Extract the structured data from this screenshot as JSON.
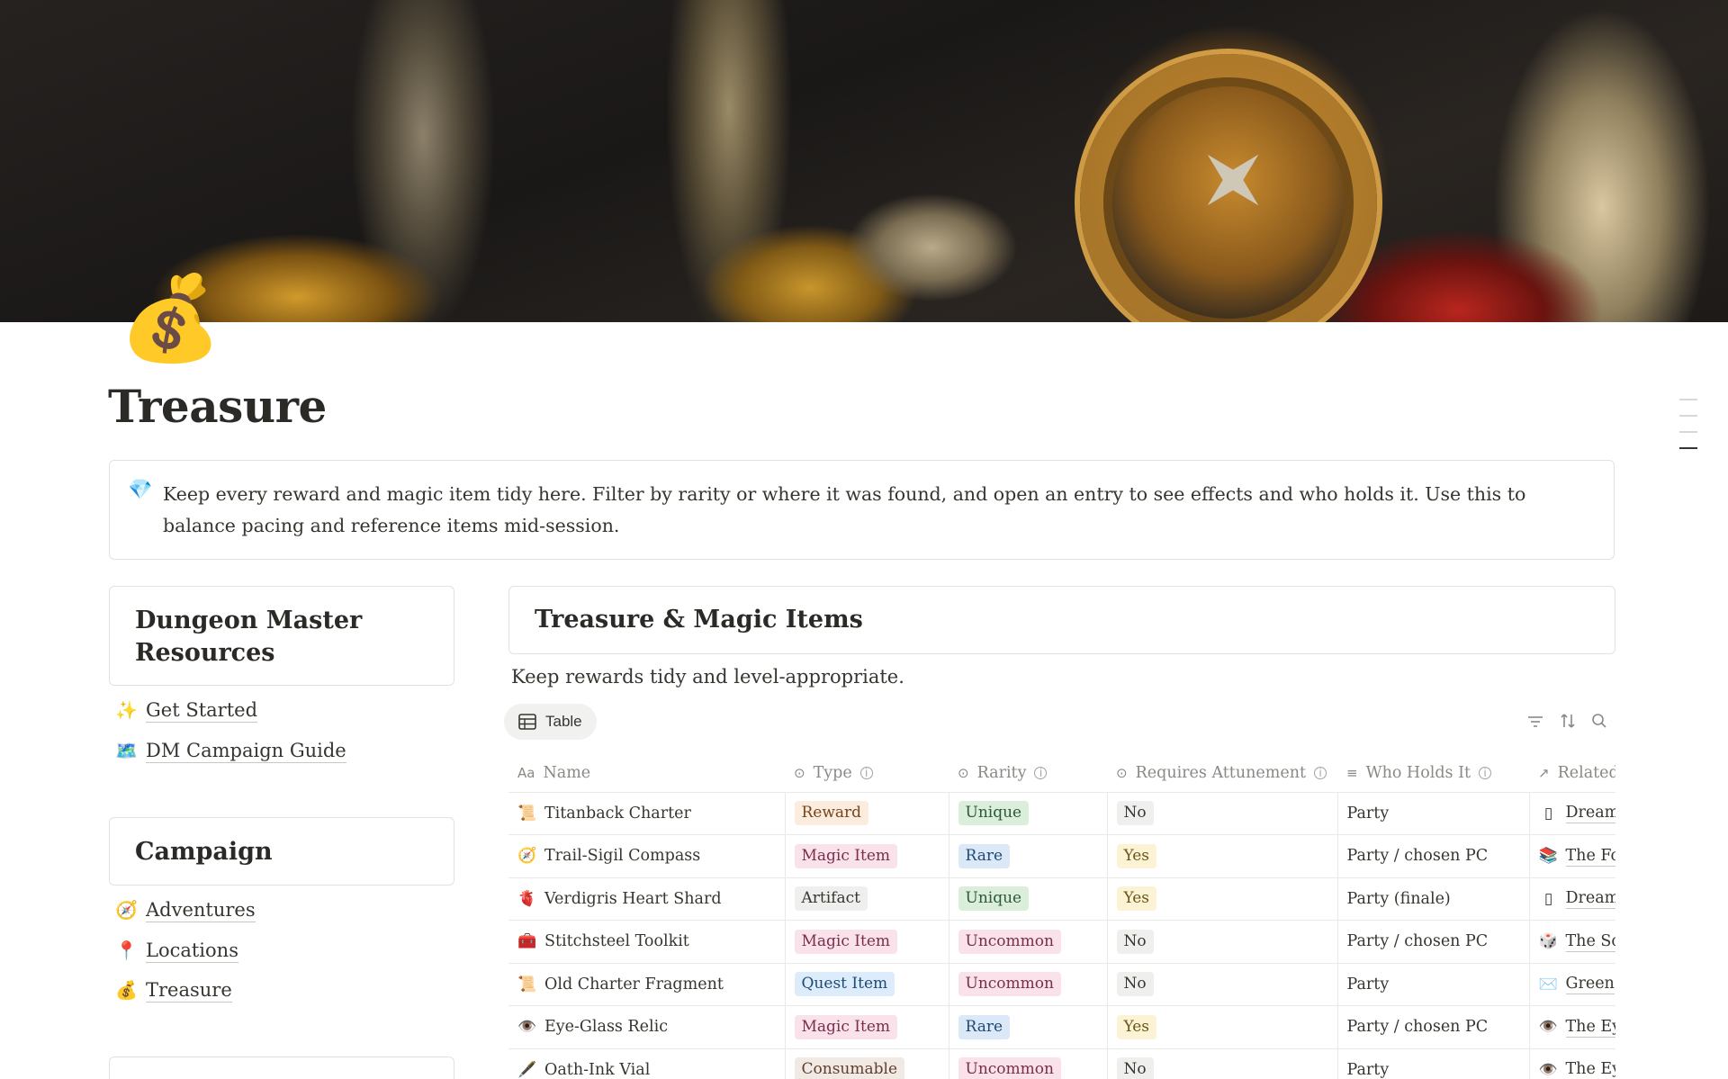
{
  "page": {
    "icon": "💰",
    "title": "Treasure"
  },
  "callout": {
    "icon": "💎",
    "text": "Keep every reward and magic item tidy here. Filter by rarity or where it was found, and open an entry to see effects and who holds it. Use this to balance pacing and reference items mid-session."
  },
  "sidebar": {
    "dm_heading": "Dungeon Master Resources",
    "dm_links": [
      {
        "icon": "✨",
        "label": "Get Started"
      },
      {
        "icon": "🗺️",
        "label": "DM Campaign Guide"
      }
    ],
    "campaign_heading": "Campaign",
    "campaign_links": [
      {
        "icon": "🧭",
        "label": "Adventures"
      },
      {
        "icon": "📍",
        "label": "Locations"
      },
      {
        "icon": "💰",
        "label": "Treasure"
      }
    ]
  },
  "database": {
    "heading": "Treasure & Magic Items",
    "description": "Keep rewards tidy and level-appropriate.",
    "view_tab": {
      "icon": "table-icon",
      "label": "Table"
    },
    "toolbar_icons": [
      "filter-icon",
      "sort-icon",
      "search-icon"
    ],
    "columns": [
      {
        "icon": "Aa",
        "label": "Name",
        "info": false
      },
      {
        "icon": "⊙",
        "label": "Type",
        "info": true
      },
      {
        "icon": "⊙",
        "label": "Rarity",
        "info": true
      },
      {
        "icon": "⊙",
        "label": "Requires Attunement",
        "info": true
      },
      {
        "icon": "≡",
        "label": "Who Holds It",
        "info": true
      },
      {
        "icon": "↗",
        "label": "Related",
        "info": false
      }
    ],
    "rows": [
      {
        "icon": "📜",
        "name": "Titanback Charter",
        "type": "Reward",
        "rarity": "Unique",
        "attune": "No",
        "holder": "Party",
        "rel_icon": "▯",
        "related": "Dream"
      },
      {
        "icon": "🧭",
        "name": "Trail-Sigil Compass",
        "type": "Magic Item",
        "rarity": "Rare",
        "attune": "Yes",
        "holder": "Party / chosen PC",
        "rel_icon": "📚",
        "related": "The Fo"
      },
      {
        "icon": "🫀",
        "name": "Verdigris Heart Shard",
        "type": "Artifact",
        "rarity": "Unique",
        "attune": "Yes",
        "holder": "Party (finale)",
        "rel_icon": "▯",
        "related": "Dream"
      },
      {
        "icon": "🧰",
        "name": "Stitchsteel Toolkit",
        "type": "Magic Item",
        "rarity": "Uncommon",
        "attune": "No",
        "holder": "Party / chosen PC",
        "rel_icon": "🎲",
        "related": "The Sc"
      },
      {
        "icon": "📜",
        "name": "Old Charter Fragment",
        "type": "Quest Item",
        "rarity": "Uncommon",
        "attune": "No",
        "holder": "Party",
        "rel_icon": "✉️",
        "related": "Green"
      },
      {
        "icon": "👁️",
        "name": "Eye-Glass Relic",
        "type": "Magic Item",
        "rarity": "Rare",
        "attune": "Yes",
        "holder": "Party / chosen PC",
        "rel_icon": "👁️",
        "related": "The Ey"
      },
      {
        "icon": "🖋️",
        "name": "Oath-Ink Vial",
        "type": "Consumable",
        "rarity": "Uncommon",
        "attune": "No",
        "holder": "Party",
        "rel_icon": "👁️",
        "related": "The Ey"
      }
    ],
    "tag_colors": {
      "Reward": {
        "bg": "#fbecdd",
        "fg": "#73451f"
      },
      "Magic Item": {
        "bg": "#f9e2ea",
        "fg": "#7a2e4c"
      },
      "Artifact": {
        "bg": "#efefed",
        "fg": "#37352f"
      },
      "Quest Item": {
        "bg": "#dcecfb",
        "fg": "#1f4a73"
      },
      "Consumable": {
        "bg": "#f1e9e3",
        "fg": "#5e4030"
      },
      "Unique": {
        "bg": "#dbeddb",
        "fg": "#2b5a35"
      },
      "Rare": {
        "bg": "#dbe8f7",
        "fg": "#1f4a73"
      },
      "Uncommon": {
        "bg": "#f9e2ea",
        "fg": "#7a2e4c"
      },
      "No": {
        "bg": "#efefed",
        "fg": "#37352f"
      },
      "Yes": {
        "bg": "#fbf3d3",
        "fg": "#6b561a"
      }
    }
  }
}
